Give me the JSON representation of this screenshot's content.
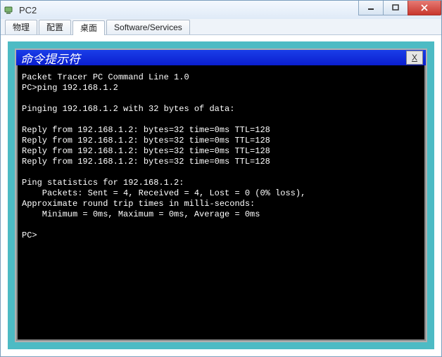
{
  "window": {
    "title": "PC2"
  },
  "tabs": [
    {
      "label": "物理"
    },
    {
      "label": "配置"
    },
    {
      "label": "桌面"
    },
    {
      "label": "Software/Services"
    }
  ],
  "active_tab_index": 2,
  "cmd": {
    "title": "命令提示符",
    "close_label": "X"
  },
  "terminal_lines": [
    "Packet Tracer PC Command Line 1.0",
    "PC>ping 192.168.1.2",
    "",
    "Pinging 192.168.1.2 with 32 bytes of data:",
    "",
    "Reply from 192.168.1.2: bytes=32 time=0ms TTL=128",
    "Reply from 192.168.1.2: bytes=32 time=0ms TTL=128",
    "Reply from 192.168.1.2: bytes=32 time=0ms TTL=128",
    "Reply from 192.168.1.2: bytes=32 time=0ms TTL=128",
    "",
    "Ping statistics for 192.168.1.2:",
    "    Packets: Sent = 4, Received = 4, Lost = 0 (0% loss),",
    "Approximate round trip times in milli-seconds:",
    "    Minimum = 0ms, Maximum = 0ms, Average = 0ms",
    "",
    "PC>"
  ]
}
